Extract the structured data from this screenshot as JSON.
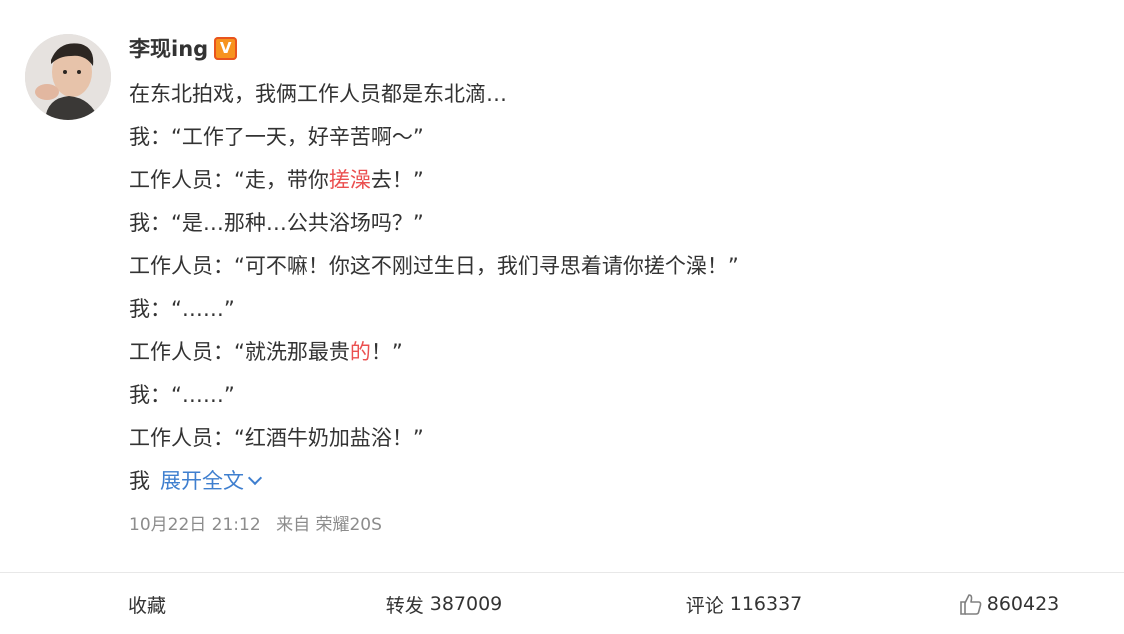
{
  "author": {
    "name": "李现ing",
    "verified_badge": "V"
  },
  "post": {
    "lines": [
      "在东北拍戏，我俩工作人员都是东北滴…",
      "我：“工作了一天，好辛苦啊～”",
      [
        "工作人员：“走，带你",
        "搓澡",
        "去！”"
      ],
      "我：“是…那种…公共浴场吗？”",
      "工作人员：“可不嘛！你这不刚过生日，我们寻思着请你搓个澡！”",
      "我：“……”",
      [
        "工作人员：“就洗那最贵",
        "的",
        "！”"
      ],
      "我：“……”",
      "工作人员：“红酒牛奶加盐浴！”"
    ],
    "last_line_text": "我",
    "expand_label": "展开全文"
  },
  "meta": {
    "timestamp": "10月22日 21:12",
    "source": "来自 荣耀20S"
  },
  "actions": {
    "favorite_label": "收藏",
    "repost_label": "转发",
    "repost_count": "387009",
    "comment_label": "评论",
    "comment_count": "116337",
    "like_count": "860423"
  },
  "colors": {
    "highlight": "#eb5050",
    "link": "#3f7fcf",
    "meta": "#8c8c8c",
    "verified": "#f7931e"
  },
  "icons": {
    "avatar": "avatar-photo",
    "verified": "verified-v-icon",
    "expand": "chevron-down-icon",
    "like": "thumbs-up-icon"
  }
}
